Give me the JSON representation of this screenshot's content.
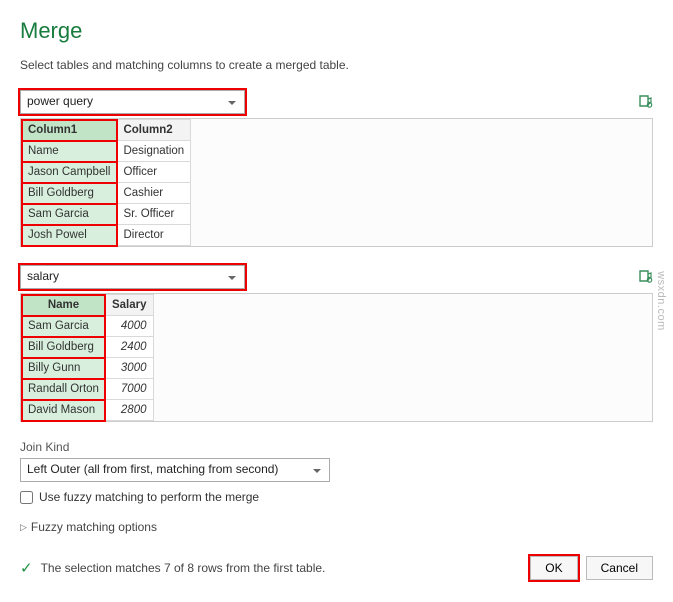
{
  "title": "Merge",
  "subtitle": "Select tables and matching columns to create a merged table.",
  "table1_selector": "power query",
  "table2_selector": "salary",
  "table1": {
    "headers": [
      "Column1",
      "Column2"
    ],
    "rows": [
      [
        "Name",
        "Designation"
      ],
      [
        "Jason Campbell",
        "Officer"
      ],
      [
        "Bill Goldberg",
        "Cashier"
      ],
      [
        "Sam Garcia",
        "Sr. Officer"
      ],
      [
        "Josh Powel",
        "Director"
      ]
    ]
  },
  "table2": {
    "headers": [
      "Name",
      "Salary"
    ],
    "rows": [
      [
        "Sam Garcia",
        "4000"
      ],
      [
        "Bill Goldberg",
        "2400"
      ],
      [
        "Billy Gunn",
        "3000"
      ],
      [
        "Randall Orton",
        "7000"
      ],
      [
        "David Mason",
        "2800"
      ]
    ]
  },
  "join_kind_label": "Join Kind",
  "join_kind_value": "Left Outer (all from first, matching from second)",
  "fuzzy_label": "Use fuzzy matching to perform the merge",
  "fuzzy_options_label": "Fuzzy matching options",
  "status_text": "The selection matches 7 of 8 rows from the first table.",
  "ok_label": "OK",
  "cancel_label": "Cancel",
  "watermark": "wsxdn.com"
}
